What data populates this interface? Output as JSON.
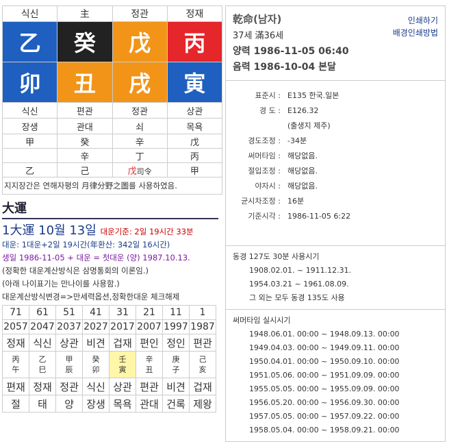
{
  "top_labels": [
    "식신",
    "主",
    "정관",
    "정재"
  ],
  "stems": [
    "乙",
    "癸",
    "戊",
    "丙"
  ],
  "branches": [
    "卯",
    "丑",
    "戌",
    "寅"
  ],
  "branch_gods": [
    "식신",
    "편관",
    "정관",
    "상관"
  ],
  "life_stages": [
    "장생",
    "관대",
    "쇠",
    "목욕"
  ],
  "hidden": [
    [
      "甲",
      "",
      "乙"
    ],
    [
      "癸",
      "辛",
      "己"
    ],
    [
      "辛",
      "丁",
      "戊",
      "司令"
    ],
    [
      "戊",
      "丙",
      "甲"
    ]
  ],
  "note": "지지장간은 연해자평의 月律分野之圖를 사용하였음.",
  "daewoon": {
    "title": "大運",
    "headline": "1大運 10월 13일",
    "basis": "대운기준: 2일 19시간 33분",
    "lines": [
      "대운: 1대운+2일 19시간(年환산: 342일 16시간)",
      "생일 1986-11-05 + 대운 = 첫대운 (양) 1987.10.13.",
      "(정확한 대운계산방식은 삼명통회의 이론임.)",
      "(아래 나이표기는 만나이를 사용함.)",
      "대운계산방식변경=>만세력옵션,정확한대운 체크해제"
    ],
    "ages": [
      "71",
      "61",
      "51",
      "41",
      "31",
      "21",
      "11",
      "1"
    ],
    "years": [
      "2057",
      "2047",
      "2037",
      "2027",
      "2017",
      "2007",
      "1997",
      "1987"
    ],
    "stem_gods": [
      "정재",
      "식신",
      "상관",
      "비견",
      "겁재",
      "편인",
      "정인",
      "편관"
    ],
    "ganzhi_top": [
      "丙",
      "乙",
      "甲",
      "癸",
      "壬",
      "辛",
      "庚",
      "己"
    ],
    "ganzhi_bottom": [
      "午",
      "巳",
      "辰",
      "卯",
      "寅",
      "丑",
      "子",
      "亥"
    ],
    "branch_gods": [
      "편재",
      "정재",
      "정관",
      "식신",
      "상관",
      "편관",
      "비견",
      "겁재"
    ],
    "stages": [
      "절",
      "태",
      "양",
      "장생",
      "목욕",
      "관대",
      "건록",
      "제왕"
    ]
  },
  "profile": {
    "title": "乾命(남자)",
    "age": "37세 滿36세",
    "solar_label": "양력",
    "solar": "1986-11-05 06:40",
    "lunar_label": "음력",
    "lunar": "1986-10-04 본달",
    "print": "인쇄하기",
    "print_bg": "배경인쇄방법"
  },
  "info_rows": [
    {
      "k": "표준시 :",
      "v": "E135 한국.일본"
    },
    {
      "k": "경 도 :",
      "v": "E126.32"
    },
    {
      "k": "",
      "v": "(출생지 제주)"
    },
    {
      "k": "경도조정 :",
      "v": "-34분"
    },
    {
      "k": "써머타임 :",
      "v": "해당없음."
    },
    {
      "k": "절입조정 :",
      "v": "해당없음."
    },
    {
      "k": "야자시 :",
      "v": "해당없음."
    },
    {
      "k": "균시차조정 :",
      "v": "16분"
    },
    {
      "k": "기준시각 :",
      "v": "1986-11-05 6:22"
    }
  ],
  "dongyeong": {
    "head": "동경 127도 30분 사용시기",
    "rows": [
      "1908.02.01. ~ 1911.12.31.",
      "1954.03.21 ~ 1961.08.09.",
      "그 외는 모두 동경 135도 사용"
    ]
  },
  "summertime": {
    "head": "써머타임 실시시기",
    "rows": [
      "1948.06.01. 00:00 ~ 1948.09.13. 00:00",
      "1949.04.03. 00:00 ~ 1949.09.11. 00:00",
      "1950.04.01. 00:00 ~ 1950.09.10. 00:00",
      "1951.05.06. 00:00 ~ 1951.09.09. 00:00",
      "1955.05.05. 00:00 ~ 1955.09.09. 00:00",
      "1956.05.20. 00:00 ~ 1956.09.30. 00:00",
      "1957.05.05. 00:00 ~ 1957.09.22. 00:00",
      "1958.05.04. 00:00 ~ 1958.09.21. 00:00"
    ]
  }
}
